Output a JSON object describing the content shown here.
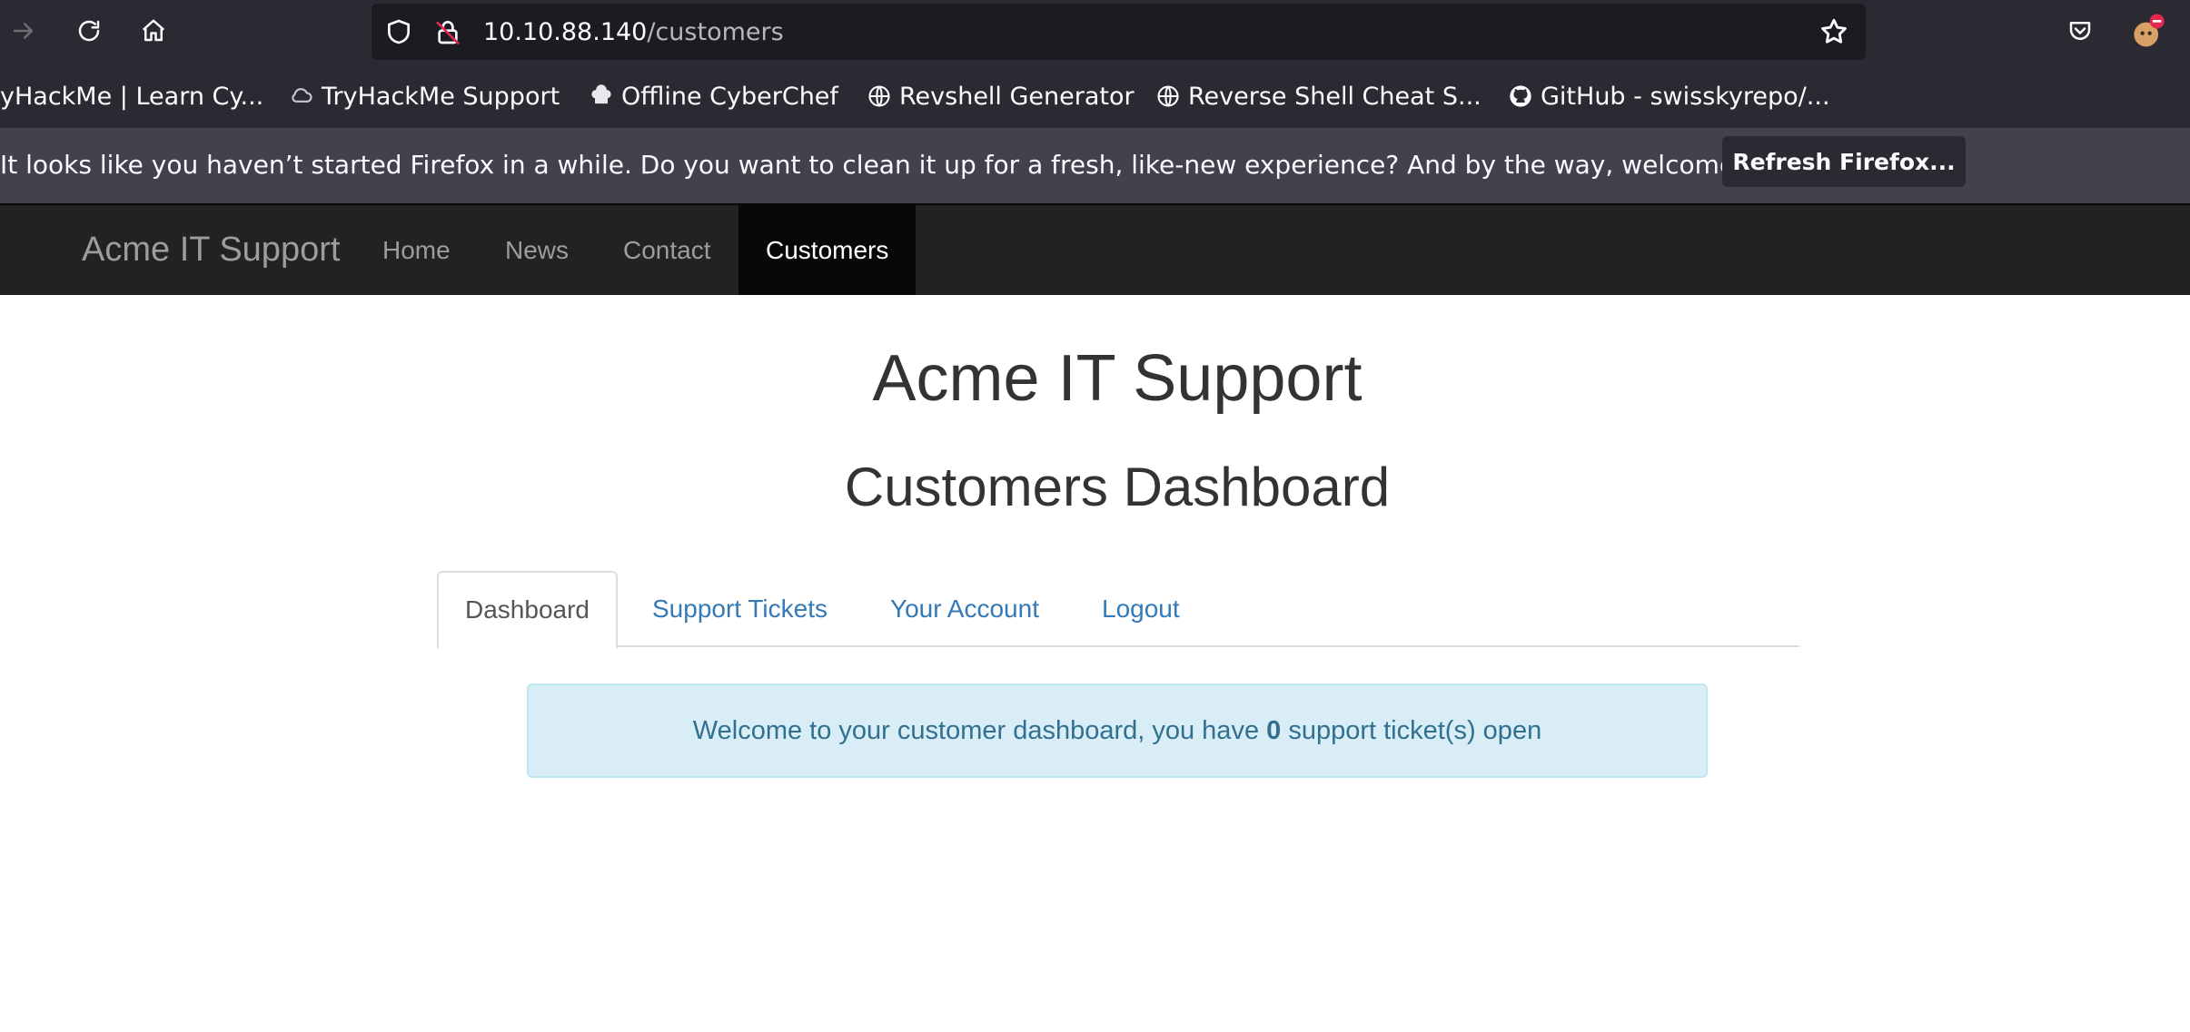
{
  "browser": {
    "url_host": "10.10.88.140",
    "url_path": "/customers",
    "bookmarks": [
      {
        "label": "yHackMe | Learn Cy...",
        "icon": "none"
      },
      {
        "label": "TryHackMe Support",
        "icon": "cloud-icon"
      },
      {
        "label": "Offline CyberChef",
        "icon": "chef-hat-icon"
      },
      {
        "label": "Revshell Generator",
        "icon": "globe-icon"
      },
      {
        "label": "Reverse Shell Cheat S...",
        "icon": "globe-icon"
      },
      {
        "label": "GitHub - swisskyrepo/...",
        "icon": "github-icon"
      }
    ],
    "notice_text": "It looks like you haven’t started Firefox in a while. Do you want to clean it up for a fresh, like-new experience? And by the way, welcome back!",
    "refresh_button": "Refresh Firefox..."
  },
  "site": {
    "brand": "Acme IT Support",
    "nav": [
      "Home",
      "News",
      "Contact",
      "Customers"
    ],
    "active_nav": "Customers",
    "heading": "Acme IT Support",
    "subheading": "Customers Dashboard",
    "tabs": [
      "Dashboard",
      "Support Tickets",
      "Your Account",
      "Logout"
    ],
    "active_tab": "Dashboard",
    "alert": {
      "prefix": "Welcome to your customer dashboard, you have ",
      "count": "0",
      "suffix": " support ticket(s) open"
    }
  },
  "colors": {
    "chrome_bg": "#2b2a33",
    "navbar_bg": "#222222",
    "link": "#337ab7",
    "alert_bg": "#d9edf7",
    "alert_text": "#31708f"
  }
}
